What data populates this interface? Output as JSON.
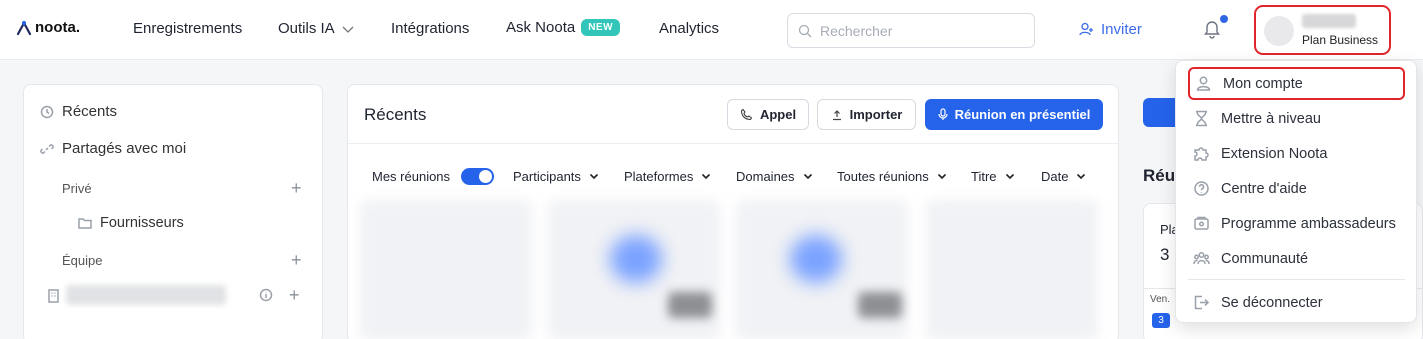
{
  "brand": {
    "logo_text": "noota."
  },
  "nav": {
    "recordings": "Enregistrements",
    "ai_tools": "Outils IA",
    "integrations": "Intégrations",
    "ask_noota": "Ask Noota",
    "new_badge": "NEW",
    "analytics": "Analytics"
  },
  "search": {
    "placeholder": "Rechercher"
  },
  "header": {
    "invite_label": "Inviter",
    "plan_label": "Plan Business"
  },
  "sidebar": {
    "recent": "Récents",
    "shared": "Partagés avec moi",
    "private": "Privé",
    "folder": "Fournisseurs",
    "team": "Équipe"
  },
  "main": {
    "title": "Récents",
    "call_button": "Appel",
    "import_button": "Importer",
    "in_person_button": "Réunion en présentiel",
    "filters": {
      "my_meetings": "Mes réunions",
      "participants": "Participants",
      "platforms": "Plateformes",
      "domains": "Domaines",
      "all_meetings": "Toutes réunions",
      "title": "Titre",
      "date": "Date"
    }
  },
  "right_panel": {
    "title_partial": "Réu",
    "card_label_partial": "Pla",
    "card_value": "3",
    "day_label": "Ven.",
    "day_number": "3"
  },
  "account_menu": {
    "items": [
      {
        "label": "Mon compte",
        "icon": "user-icon"
      },
      {
        "label": "Mettre à niveau",
        "icon": "hourglass-icon"
      },
      {
        "label": "Extension Noota",
        "icon": "puzzle-icon"
      },
      {
        "label": "Centre d'aide",
        "icon": "help-circle-icon"
      },
      {
        "label": "Programme ambassadeurs",
        "icon": "gift-card-icon"
      },
      {
        "label": "Communauté",
        "icon": "users-icon"
      }
    ],
    "logout": "Se déconnecter"
  },
  "colors": {
    "accent": "#2563eb",
    "highlight": "#e0252b",
    "new_badge": "#31c6b9"
  }
}
